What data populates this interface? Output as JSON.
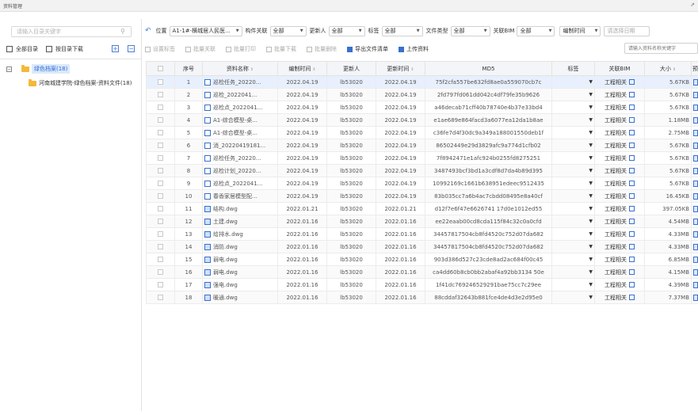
{
  "window": {
    "title": "资料管理",
    "corner": "⇗"
  },
  "left": {
    "search_placeholder": "请输入目录关键字",
    "all_label": "全部目录",
    "download_label": "按目录下载",
    "tree_root": "绿色档案(18)",
    "tree_child": "河南城建学院-绿色档案-资料文件(18)"
  },
  "filters": {
    "position_label": "位置",
    "position_value": "A1-1#-横城居人民医...",
    "component_label": "构件关联",
    "component_value": "全部",
    "updater_label": "更新人",
    "updater_value": "全部",
    "tag_label": "标签",
    "tag_value": "全部",
    "filetype_label": "文件类型",
    "filetype_value": "全部",
    "bim_label": "关联BIM",
    "bim_value": "全部",
    "date_label": "编制时间",
    "date_placeholder": "请选择日期"
  },
  "actions": [
    "设置标签",
    "批量关联",
    "批量打印",
    "批量下载",
    "批量删除",
    "导出文件清单",
    "上传资料"
  ],
  "right_search_placeholder": "请输入资料名称关键字",
  "columns": [
    "序号",
    "资料名称",
    "编制时间",
    "更新人",
    "更新时间",
    "MD5",
    "标签",
    "关联BIM",
    "大小",
    "预"
  ],
  "rows": [
    {
      "no": "1",
      "name": "巡检任务_20220...",
      "made": "2022.04.19",
      "user": "lb53020",
      "upd": "2022.04.19",
      "md5": "75f2cfa557be632fd8ae0a559070cb7c",
      "bim": "工程相关",
      "size": "5.67KB",
      "type": "doc"
    },
    {
      "no": "2",
      "name": "巡检_2022041...",
      "made": "2022.04.19",
      "user": "lb53020",
      "upd": "2022.04.19",
      "md5": "2fd797fd061dd042c4df79fe35b9626",
      "bim": "工程相关",
      "size": "5.67KB",
      "type": "doc"
    },
    {
      "no": "3",
      "name": "巡检点_2022041...",
      "made": "2022.04.19",
      "user": "lb53020",
      "upd": "2022.04.19",
      "md5": "a46decab71cff40b78740e4b37e33bd4",
      "bim": "工程相关",
      "size": "5.67KB",
      "type": "doc"
    },
    {
      "no": "4",
      "name": "A1-综合模型-桌...",
      "made": "2022.04.19",
      "user": "lb53020",
      "upd": "2022.04.19",
      "md5": "e1ae689e864facd3a6077ea12da1b8ae",
      "bim": "工程相关",
      "size": "1.18MB",
      "type": "doc"
    },
    {
      "no": "5",
      "name": "A1-综合模型-桌...",
      "made": "2022.04.19",
      "user": "lb53020",
      "upd": "2022.04.19",
      "md5": "c36fe7d4f30dc9a349a188001550deb1f",
      "bim": "工程相关",
      "size": "2.75MB",
      "type": "doc"
    },
    {
      "no": "6",
      "name": "消_20220419181...",
      "made": "2022.04.19",
      "user": "lb53020",
      "upd": "2022.04.19",
      "md5": "86502449e29d3829afc9a774d1cfb02",
      "bim": "工程相关",
      "size": "5.67KB",
      "type": "doc"
    },
    {
      "no": "7",
      "name": "巡检任务_20220...",
      "made": "2022.04.19",
      "user": "lb53020",
      "upd": "2022.04.19",
      "md5": "7f8942471e1afc924b0255fd8275251",
      "bim": "工程相关",
      "size": "5.67KB",
      "type": "doc"
    },
    {
      "no": "8",
      "name": "巡检计划_20220...",
      "made": "2022.04.19",
      "user": "lb53020",
      "upd": "2022.04.19",
      "md5": "3487493bcf3bd1a3cdf8d7da4b89d395",
      "bim": "工程相关",
      "size": "5.67KB",
      "type": "doc"
    },
    {
      "no": "9",
      "name": "巡检点_2022041...",
      "made": "2022.04.19",
      "user": "lb53020",
      "upd": "2022.04.19",
      "md5": "10992169c1661b638951edeec9512435",
      "bim": "工程相关",
      "size": "5.67KB",
      "type": "doc"
    },
    {
      "no": "10",
      "name": "春香家居模型配...",
      "made": "2022.04.19",
      "user": "lb53020",
      "upd": "2022.04.19",
      "md5": "83b035cc7a6b4ac7cbdd08495e8a40cf",
      "bim": "工程相关",
      "size": "16.45KB",
      "type": "doc"
    },
    {
      "no": "11",
      "name": "结构.dwg",
      "made": "2022.01.21",
      "user": "lb53020",
      "upd": "2022.01.21",
      "md5": "d12f7e6f47e6626741 17d0e1012ed55",
      "bim": "工程相关",
      "size": "397.05KB",
      "type": "dwg"
    },
    {
      "no": "12",
      "name": "土建.dwg",
      "made": "2022.01.16",
      "user": "lb53020",
      "upd": "2022.01.16",
      "md5": "ee22eaab00cd8cda115f84c32c0a0cfd",
      "bim": "工程相关",
      "size": "4.54MB",
      "type": "dwg"
    },
    {
      "no": "13",
      "name": "给排水.dwg",
      "made": "2022.01.16",
      "user": "lb53020",
      "upd": "2022.01.16",
      "md5": "34457817504cb8fd4520c752d07da682",
      "bim": "工程相关",
      "size": "4.33MB",
      "type": "dwg"
    },
    {
      "no": "14",
      "name": "消防.dwg",
      "made": "2022.01.16",
      "user": "lb53020",
      "upd": "2022.01.16",
      "md5": "34457817504cb8fd4520c752d07da682",
      "bim": "工程相关",
      "size": "4.33MB",
      "type": "dwg"
    },
    {
      "no": "15",
      "name": "弱电.dwg",
      "made": "2022.01.16",
      "user": "lb53020",
      "upd": "2022.01.16",
      "md5": "903d386d527c23cde8ad2ac684f00c45",
      "bim": "工程相关",
      "size": "6.85MB",
      "type": "dwg"
    },
    {
      "no": "16",
      "name": "弱电.dwg",
      "made": "2022.01.16",
      "user": "lb53020",
      "upd": "2022.01.16",
      "md5": "ca4dd60b8cb0bb2abaf4a92bb3134 50e",
      "bim": "工程相关",
      "size": "4.15MB",
      "type": "dwg"
    },
    {
      "no": "17",
      "name": "强电.dwg",
      "made": "2022.01.16",
      "user": "lb53020",
      "upd": "2022.01.16",
      "md5": "1f41dc769246529291bae75cc7c29ee",
      "bim": "工程相关",
      "size": "4.39MB",
      "type": "dwg"
    },
    {
      "no": "18",
      "name": "暖通.dwg",
      "made": "2022.01.16",
      "user": "lb53020",
      "upd": "2022.01.16",
      "md5": "88cddaf32643b881fce4de4d3e2d95e0",
      "bim": "工程相关",
      "size": "7.37MB",
      "type": "dwg"
    }
  ]
}
